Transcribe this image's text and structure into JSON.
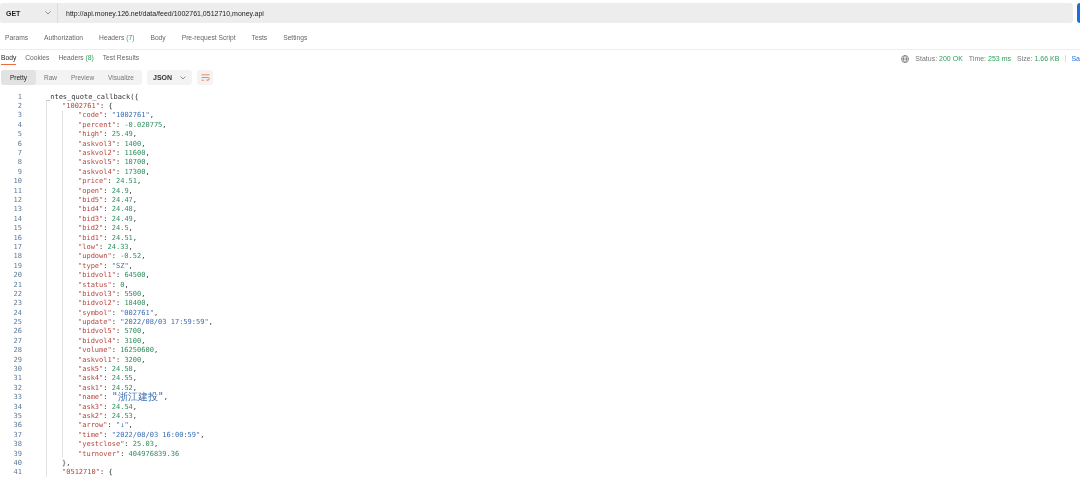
{
  "request": {
    "method": "GET",
    "url": "http://api.money.126.net/data/feed/1002761,0512710,money.api"
  },
  "request_tabs": [
    {
      "label": "Params",
      "selected": false
    },
    {
      "label": "Authorization",
      "selected": false
    },
    {
      "label": "Headers",
      "count": "(7)",
      "selected": false
    },
    {
      "label": "Body",
      "selected": false
    },
    {
      "label": "Pre-request Script",
      "selected": false
    },
    {
      "label": "Tests",
      "selected": false
    },
    {
      "label": "Settings",
      "selected": false
    }
  ],
  "response_tabs": [
    {
      "label": "Body",
      "selected": true
    },
    {
      "label": "Cookies",
      "selected": false
    },
    {
      "label": "Headers",
      "count": "(8)",
      "selected": false
    },
    {
      "label": "Test Results",
      "selected": false
    }
  ],
  "status": [
    {
      "label": "Status:",
      "value": "200 OK"
    },
    {
      "label": "Time:",
      "value": "253 ms"
    },
    {
      "label": "Size:",
      "value": "1.66 KB"
    }
  ],
  "save_link": "Sa",
  "view_modes": [
    {
      "label": "Pretty",
      "selected": true
    },
    {
      "label": "Raw",
      "selected": false
    },
    {
      "label": "Preview",
      "selected": false
    },
    {
      "label": "Visualize",
      "selected": false
    }
  ],
  "format": "JSON",
  "code_lines": [
    {
      "no": "1",
      "text": "_ntes_quote_callback({",
      "children": [
        {
          "no": "2",
          "key": "\"1002761\"",
          "sep": ":",
          "value": "{",
          "kind": "punct",
          "children": [
            {
              "no": "3",
              "key": "\"code\"",
              "sep": ":",
              "value": "\"1002761\"",
              "kind": "string",
              "tail": ","
            },
            {
              "no": "4",
              "key": "\"percent\"",
              "sep": ":",
              "value": "-0.020775",
              "kind": "number",
              "tail": ","
            },
            {
              "no": "5",
              "key": "\"high\"",
              "sep": ":",
              "value": "25.49",
              "kind": "number",
              "tail": ","
            },
            {
              "no": "6",
              "key": "\"askvol3\"",
              "sep": ":",
              "value": "1400",
              "kind": "number",
              "tail": ","
            },
            {
              "no": "7",
              "key": "\"askvol2\"",
              "sep": ":",
              "value": "11600",
              "kind": "number",
              "tail": ","
            },
            {
              "no": "8",
              "key": "\"askvol5\"",
              "sep": ":",
              "value": "10700",
              "kind": "number",
              "tail": ","
            },
            {
              "no": "9",
              "key": "\"askvol4\"",
              "sep": ":",
              "value": "17300",
              "kind": "number",
              "tail": ","
            },
            {
              "no": "10",
              "key": "\"price\"",
              "sep": ":",
              "value": "24.51",
              "kind": "number",
              "tail": ","
            },
            {
              "no": "11",
              "key": "\"open\"",
              "sep": ":",
              "value": "24.9",
              "kind": "number",
              "tail": ","
            },
            {
              "no": "12",
              "key": "\"bid5\"",
              "sep": ":",
              "value": "24.47",
              "kind": "number",
              "tail": ","
            },
            {
              "no": "13",
              "key": "\"bid4\"",
              "sep": ":",
              "value": "24.48",
              "kind": "number",
              "tail": ","
            },
            {
              "no": "14",
              "key": "\"bid3\"",
              "sep": ":",
              "value": "24.49",
              "kind": "number",
              "tail": ","
            },
            {
              "no": "15",
              "key": "\"bid2\"",
              "sep": ":",
              "value": "24.5",
              "kind": "number",
              "tail": ","
            },
            {
              "no": "16",
              "key": "\"bid1\"",
              "sep": ":",
              "value": "24.51",
              "kind": "number",
              "tail": ","
            },
            {
              "no": "17",
              "key": "\"low\"",
              "sep": ":",
              "value": "24.33",
              "kind": "number",
              "tail": ","
            },
            {
              "no": "18",
              "key": "\"updown\"",
              "sep": ":",
              "value": "-0.52",
              "kind": "number",
              "tail": ","
            },
            {
              "no": "19",
              "key": "\"type\"",
              "sep": ":",
              "value": "\"SZ\"",
              "kind": "string",
              "tail": ","
            },
            {
              "no": "20",
              "key": "\"bidvol1\"",
              "sep": ":",
              "value": "64500",
              "kind": "number",
              "tail": ","
            },
            {
              "no": "21",
              "key": "\"status\"",
              "sep": ":",
              "value": "0",
              "kind": "number",
              "tail": ","
            },
            {
              "no": "22",
              "key": "\"bidvol3\"",
              "sep": ":",
              "value": "5500",
              "kind": "number",
              "tail": ","
            },
            {
              "no": "23",
              "key": "\"bidvol2\"",
              "sep": ":",
              "value": "18400",
              "kind": "number",
              "tail": ","
            },
            {
              "no": "24",
              "key": "\"symbol\"",
              "sep": ":",
              "value": "\"002761\"",
              "kind": "string",
              "tail": ","
            },
            {
              "no": "25",
              "key": "\"update\"",
              "sep": ":",
              "value": "\"2022/08/03 17:59:59\"",
              "kind": "string",
              "tail": ","
            },
            {
              "no": "26",
              "key": "\"bidvol5\"",
              "sep": ":",
              "value": "5700",
              "kind": "number",
              "tail": ","
            },
            {
              "no": "27",
              "key": "\"bidvol4\"",
              "sep": ":",
              "value": "3100",
              "kind": "number",
              "tail": ","
            },
            {
              "no": "28",
              "key": "\"volume\"",
              "sep": ":",
              "value": "16250600",
              "kind": "number",
              "tail": ","
            },
            {
              "no": "29",
              "key": "\"askvol1\"",
              "sep": ":",
              "value": "3200",
              "kind": "number",
              "tail": ","
            },
            {
              "no": "30",
              "key": "\"ask5\"",
              "sep": ":",
              "value": "24.58",
              "kind": "number",
              "tail": ","
            },
            {
              "no": "31",
              "key": "\"ask4\"",
              "sep": ":",
              "value": "24.55",
              "kind": "number",
              "tail": ","
            },
            {
              "no": "32",
              "key": "\"ask1\"",
              "sep": ":",
              "value": "24.52",
              "kind": "number",
              "tail": ","
            },
            {
              "no": "33",
              "key": "\"name\"",
              "sep": ":",
              "value": "\"浙江建投\"",
              "kind": "string",
              "tail": ","
            },
            {
              "no": "34",
              "key": "\"ask3\"",
              "sep": ":",
              "value": "24.54",
              "kind": "number",
              "tail": ","
            },
            {
              "no": "35",
              "key": "\"ask2\"",
              "sep": ":",
              "value": "24.53",
              "kind": "number",
              "tail": ","
            },
            {
              "no": "36",
              "key": "\"arrow\"",
              "sep": ":",
              "value": "\"↓\"",
              "kind": "string",
              "tail": ","
            },
            {
              "no": "37",
              "key": "\"time\"",
              "sep": ":",
              "value": "\"2022/08/03 16:00:59\"",
              "kind": "string",
              "tail": ","
            },
            {
              "no": "38",
              "key": "\"yestclose\"",
              "sep": ":",
              "value": "25.03",
              "kind": "number",
              "tail": ","
            },
            {
              "no": "39",
              "key": "\"turnover\"",
              "sep": ":",
              "value": "404976839.36",
              "kind": "number"
            }
          ]
        },
        {
          "no": "40",
          "text": "},"
        },
        {
          "no": "41",
          "key": "\"0512710\"",
          "sep": ":",
          "value": "{",
          "kind": "punct"
        }
      ]
    }
  ]
}
